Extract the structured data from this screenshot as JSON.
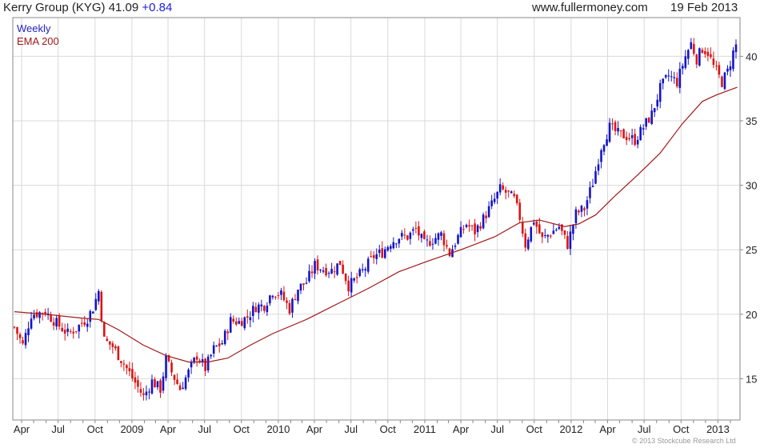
{
  "header": {
    "title": "Kerry Group (KYG) 41.09",
    "change": "+0.84",
    "site": "www.fullermoney.com",
    "date": "19 Feb 2013"
  },
  "footer": {
    "copyright": "© 2013 Stockcube Research Ltd"
  },
  "colors": {
    "up": "#1414c8",
    "down": "#dc1414",
    "ema": "#a01818",
    "grid": "#d9d9d9",
    "frame": "#8a8a8a"
  },
  "chart_data": {
    "type": "candlestick",
    "title": "Kerry Group (KYG) 41.09 +0.84",
    "legend": [
      "Weekly",
      "EMA 200"
    ],
    "legend_position": "top-left",
    "x_tick_labels": [
      "Apr",
      "Jul",
      "Oct",
      "2009",
      "Apr",
      "Jul",
      "Oct",
      "2010",
      "Apr",
      "Jul",
      "Oct",
      "2011",
      "Apr",
      "Jul",
      "Oct",
      "2012",
      "Apr",
      "Jul",
      "Oct",
      "2013"
    ],
    "y_ticks": [
      15,
      20,
      25,
      30,
      35,
      40
    ],
    "ylim": [
      11.8,
      43.0
    ],
    "xlim": [
      "2008-03-10",
      "2013-02-25"
    ],
    "grid": true,
    "price_path": [
      [
        "2008-03-14",
        19.0
      ],
      [
        "2008-04-04",
        17.6
      ],
      [
        "2008-04-25",
        20.0
      ],
      [
        "2008-05-30",
        20.2
      ],
      [
        "2008-06-27",
        19.3
      ],
      [
        "2008-07-25",
        18.5
      ],
      [
        "2008-08-15",
        18.9
      ],
      [
        "2008-09-12",
        19.7
      ],
      [
        "2008-09-26",
        20.5
      ],
      [
        "2008-10-10",
        21.8
      ],
      [
        "2008-10-24",
        18.0
      ],
      [
        "2008-11-14",
        17.5
      ],
      [
        "2008-12-05",
        16.5
      ],
      [
        "2008-12-19",
        15.8
      ],
      [
        "2009-01-09",
        14.7
      ],
      [
        "2009-01-30",
        13.6
      ],
      [
        "2009-02-20",
        14.8
      ],
      [
        "2009-03-13",
        14.2
      ],
      [
        "2009-03-27",
        16.5
      ],
      [
        "2009-04-10",
        15.5
      ],
      [
        "2009-05-01",
        14.2
      ],
      [
        "2009-05-22",
        15.5
      ],
      [
        "2009-06-12",
        16.8
      ],
      [
        "2009-07-03",
        15.8
      ],
      [
        "2009-07-24",
        17.3
      ],
      [
        "2009-08-14",
        17.8
      ],
      [
        "2009-09-04",
        19.5
      ],
      [
        "2009-09-25",
        19.4
      ],
      [
        "2009-10-16",
        19.8
      ],
      [
        "2009-11-06",
        20.6
      ],
      [
        "2009-11-27",
        20.7
      ],
      [
        "2009-12-18",
        21.8
      ],
      [
        "2010-01-08",
        21.5
      ],
      [
        "2010-01-29",
        20.4
      ],
      [
        "2010-02-19",
        22.0
      ],
      [
        "2010-03-12",
        22.5
      ],
      [
        "2010-04-02",
        23.8
      ],
      [
        "2010-04-23",
        23.5
      ],
      [
        "2010-05-14",
        23.4
      ],
      [
        "2010-06-04",
        24.0
      ],
      [
        "2010-06-25",
        22.2
      ],
      [
        "2010-07-16",
        22.8
      ],
      [
        "2010-08-06",
        23.6
      ],
      [
        "2010-08-27",
        24.5
      ],
      [
        "2010-09-17",
        24.8
      ],
      [
        "2010-10-08",
        25.6
      ],
      [
        "2010-10-29",
        26.0
      ],
      [
        "2010-11-19",
        26.0
      ],
      [
        "2010-12-10",
        26.6
      ],
      [
        "2010-12-31",
        25.4
      ],
      [
        "2011-01-21",
        25.8
      ],
      [
        "2011-02-11",
        26.2
      ],
      [
        "2011-03-04",
        24.7
      ],
      [
        "2011-03-25",
        26.0
      ],
      [
        "2011-04-15",
        27.0
      ],
      [
        "2011-05-06",
        26.4
      ],
      [
        "2011-05-27",
        27.4
      ],
      [
        "2011-06-17",
        28.5
      ],
      [
        "2011-07-08",
        29.7
      ],
      [
        "2011-07-29",
        29.3
      ],
      [
        "2011-08-12",
        28.9
      ],
      [
        "2011-08-26",
        27.5
      ],
      [
        "2011-09-09",
        25.4
      ],
      [
        "2011-09-30",
        27.3
      ],
      [
        "2011-10-21",
        25.8
      ],
      [
        "2011-11-11",
        26.3
      ],
      [
        "2011-12-02",
        26.8
      ],
      [
        "2011-12-23",
        25.4
      ],
      [
        "2012-01-13",
        27.8
      ],
      [
        "2012-02-03",
        28.2
      ],
      [
        "2012-02-24",
        30.2
      ],
      [
        "2012-03-16",
        33.0
      ],
      [
        "2012-04-06",
        34.5
      ],
      [
        "2012-04-27",
        34.0
      ],
      [
        "2012-05-18",
        33.8
      ],
      [
        "2012-06-08",
        33.5
      ],
      [
        "2012-06-29",
        34.5
      ],
      [
        "2012-07-20",
        35.5
      ],
      [
        "2012-08-10",
        37.5
      ],
      [
        "2012-08-31",
        38.5
      ],
      [
        "2012-09-21",
        38.0
      ],
      [
        "2012-10-12",
        40.0
      ],
      [
        "2012-10-26",
        41.0
      ],
      [
        "2012-11-09",
        39.8
      ],
      [
        "2012-11-23",
        40.6
      ],
      [
        "2012-12-07",
        40.3
      ],
      [
        "2012-12-21",
        39.2
      ],
      [
        "2013-01-11",
        38.0
      ],
      [
        "2013-01-25",
        38.8
      ],
      [
        "2013-02-08",
        40.3
      ],
      [
        "2013-02-18",
        41.09
      ]
    ],
    "ema_200_path": [
      [
        "2008-03-14",
        20.2
      ],
      [
        "2008-05-30",
        20.0
      ],
      [
        "2008-08-29",
        19.7
      ],
      [
        "2008-10-10",
        19.6
      ],
      [
        "2008-11-28",
        18.8
      ],
      [
        "2009-01-30",
        17.6
      ],
      [
        "2009-03-27",
        16.8
      ],
      [
        "2009-05-22",
        16.3
      ],
      [
        "2009-07-10",
        16.3
      ],
      [
        "2009-08-28",
        16.6
      ],
      [
        "2009-10-23",
        17.6
      ],
      [
        "2009-12-18",
        18.5
      ],
      [
        "2010-03-12",
        19.6
      ],
      [
        "2010-05-28",
        20.8
      ],
      [
        "2010-08-13",
        22.0
      ],
      [
        "2010-10-29",
        23.3
      ],
      [
        "2011-01-07",
        24.1
      ],
      [
        "2011-04-01",
        25.0
      ],
      [
        "2011-06-24",
        26.0
      ],
      [
        "2011-08-26",
        27.1
      ],
      [
        "2011-10-14",
        27.3
      ],
      [
        "2011-12-16",
        26.8
      ],
      [
        "2012-01-20",
        27.0
      ],
      [
        "2012-03-02",
        27.7
      ],
      [
        "2012-04-20",
        29.2
      ],
      [
        "2012-06-15",
        30.8
      ],
      [
        "2012-08-10",
        32.5
      ],
      [
        "2012-10-05",
        34.8
      ],
      [
        "2012-11-23",
        36.5
      ],
      [
        "2012-12-28",
        37.0
      ],
      [
        "2013-02-18",
        37.6
      ]
    ]
  }
}
